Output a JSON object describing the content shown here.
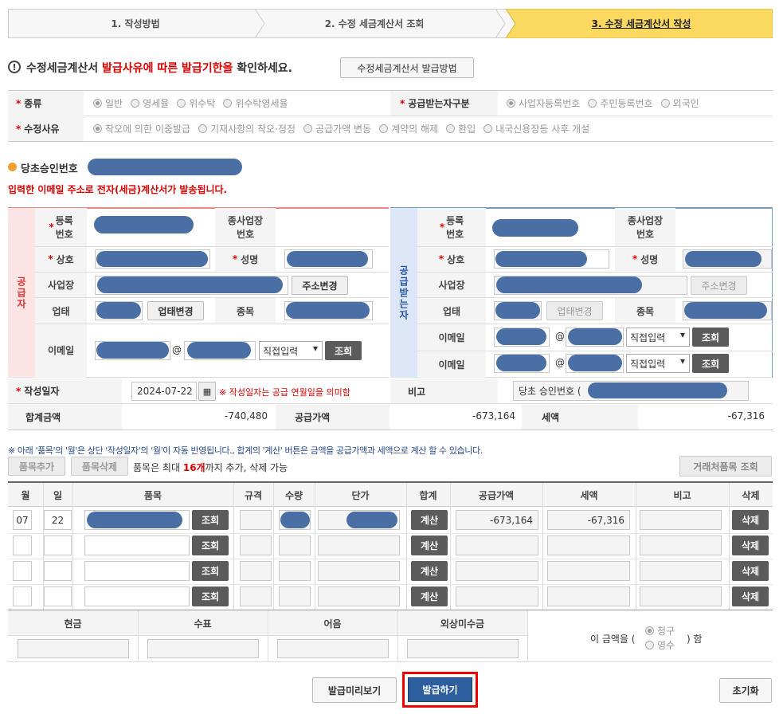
{
  "steps": [
    "1. 작성방법",
    "2. 수정 세금계산서 조회",
    "3. 수정 세금계산서 작성"
  ],
  "notice": {
    "a": "수정세금계산서 ",
    "b": "발급사유에 따른 발급기한을",
    "c": " 확인하세요.",
    "button": "수정세금계산서 발급방법"
  },
  "kind": {
    "label": "종류",
    "options": [
      "일반",
      "영세율",
      "위수탁",
      "위수탁영세율"
    ]
  },
  "recvType": {
    "label": "공급받는자구분",
    "options": [
      "사업자등록번호",
      "주민등록번호",
      "외국인"
    ]
  },
  "reason": {
    "label": "수정사유",
    "options": [
      "착오에 의한 이중발급",
      "기재사항의 착오·정정",
      "공급가액 변동",
      "계약의 해제",
      "환입",
      "내국신용장등 사후 개설"
    ]
  },
  "approval": {
    "label": "당초승인번호"
  },
  "emailNotice": "입력한 이메일 주소로 전자(세금)계산서가 발송됩니다.",
  "supplier": {
    "side": "공급자",
    "regno": "등록\n번호",
    "subbiz": "종사업장\n번호",
    "name": "상호",
    "ceo": "성명",
    "addr": "사업장",
    "addrBtn": "주소변경",
    "type": "업태",
    "typeBtn": "업태변경",
    "item": "종목",
    "email": "이메일",
    "emailSelect": "직접입력",
    "lookup": "조회"
  },
  "buyer": {
    "side": "공급받는자",
    "regno": "등록\n번호",
    "subbiz": "종사업장\n번호",
    "name": "상호",
    "ceo": "성명",
    "addr": "사업장",
    "addrBtn": "주소변경",
    "type": "업태",
    "typeBtn": "업태변경",
    "item": "종목",
    "email": "이메일",
    "emailSelect": "직접입력",
    "lookup": "조회"
  },
  "writeDate": {
    "label": "작성일자",
    "value": "2024-07-22",
    "note": "※ 작성일자는 공급 연월일을 의미함"
  },
  "remark": {
    "label": "비고",
    "value": "당초 승인번호 ("
  },
  "totals": {
    "totalLabel": "합계금액",
    "total": "-740,480",
    "supplyLabel": "공급가액",
    "supply": "-673,164",
    "taxLabel": "세액",
    "tax": "-67,316"
  },
  "itemNotice": "※ 아래 '품목'의 '월'은 상단 '작성일자'의 '월'이 자동 반영됩니다., 합계의 '계산' 버튼은 금액을 공급가액과 세액으로 계산 할 수 있습니다.",
  "itemButtons": {
    "add": "품목추가",
    "del": "품목삭제",
    "limitA": "품목은 최대 ",
    "limitB": "16개",
    "limitC": "까지 추가, 삭제 가능",
    "partner": "거래처품목 조회"
  },
  "itemTable": {
    "headers": [
      "월",
      "일",
      "품목",
      "규격",
      "수량",
      "단가",
      "합계",
      "공급가액",
      "세액",
      "비고",
      "삭제"
    ],
    "lookup": "조회",
    "calc": "계산",
    "del": "삭제",
    "rows": [
      {
        "m": "07",
        "d": "22",
        "supply": "-673,164",
        "tax": "-67,316"
      },
      {
        "m": "",
        "d": "",
        "supply": "",
        "tax": ""
      },
      {
        "m": "",
        "d": "",
        "supply": "",
        "tax": ""
      },
      {
        "m": "",
        "d": "",
        "supply": "",
        "tax": ""
      }
    ]
  },
  "payment": {
    "headers": [
      "현금",
      "수표",
      "어음",
      "외상미수금"
    ],
    "prefix": "이 금액을 (",
    "opt1": "청구",
    "opt2": "영수",
    "suffix": ") 함"
  },
  "footer": {
    "preview": "발급미리보기",
    "issue": "발급하기",
    "reset": "초기화"
  }
}
